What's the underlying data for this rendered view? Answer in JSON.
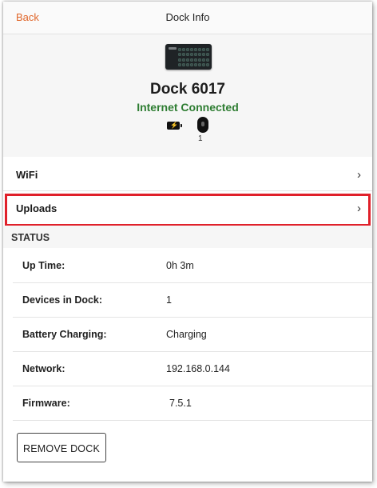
{
  "navbar": {
    "back_label": "Back",
    "title": "Dock Info"
  },
  "dock": {
    "name": "Dock 6017",
    "connection_status": "Internet Connected",
    "device_count": "1",
    "colors": {
      "connected": "#2e7d32",
      "accent": "#e0662a"
    },
    "icons": [
      "dock-image",
      "battery-charging-icon",
      "device-icon"
    ]
  },
  "menu": {
    "wifi_label": "WiFi",
    "uploads_label": "Uploads",
    "chevron": "›"
  },
  "status": {
    "heading": "STATUS",
    "rows": [
      {
        "key": "Up Time:",
        "value": "0h 3m"
      },
      {
        "key": "Devices in Dock:",
        "value": "1"
      },
      {
        "key": "Battery Charging:",
        "value": "Charging"
      },
      {
        "key": "Network:",
        "value": "192.168.0.144"
      },
      {
        "key": "Firmware:",
        "value": "7.5.1"
      }
    ]
  },
  "actions": {
    "remove_label": "REMOVE DOCK"
  },
  "highlight_color": "#e0202a"
}
